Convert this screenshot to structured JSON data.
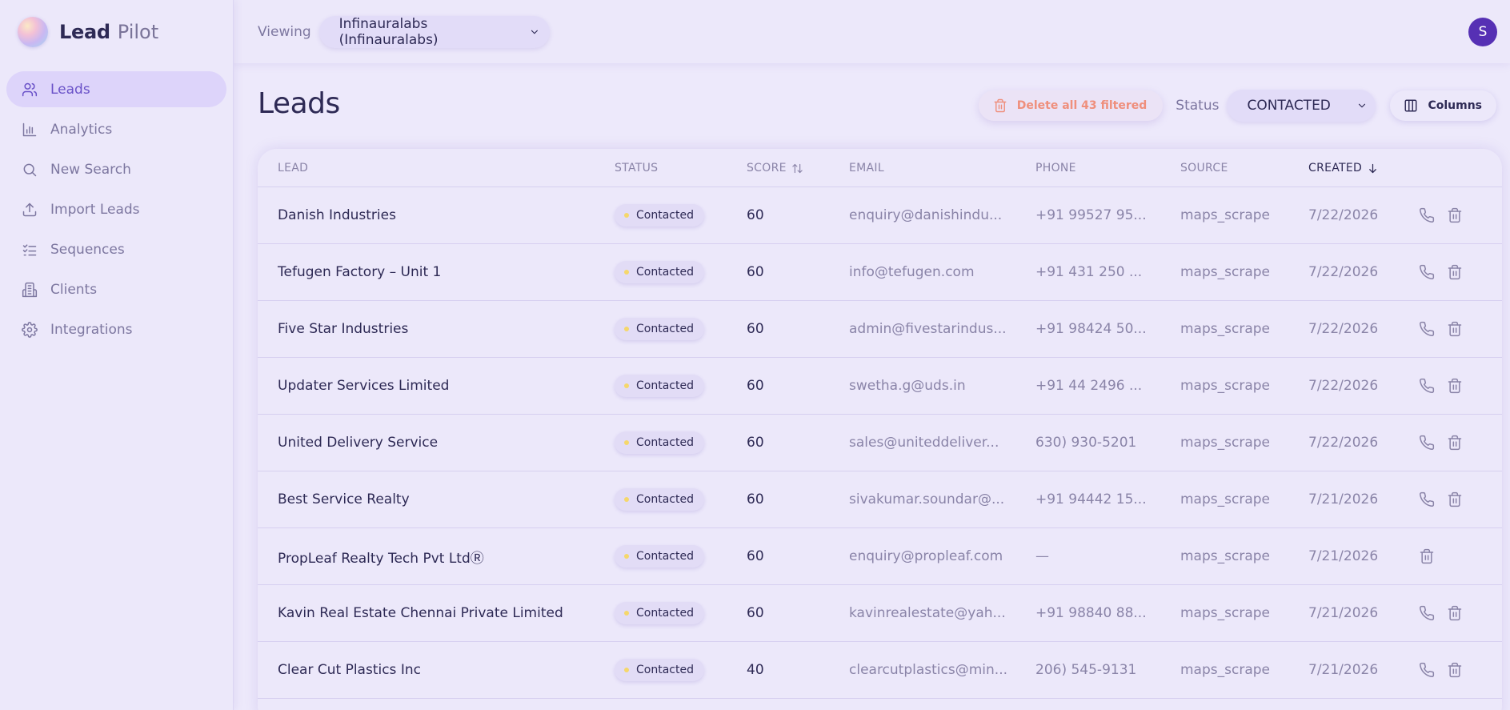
{
  "brand": {
    "name": "Lead",
    "suffix": "Pilot"
  },
  "nav": [
    {
      "label": "Leads",
      "icon": "users-icon",
      "active": true
    },
    {
      "label": "Analytics",
      "icon": "bar-chart-icon",
      "active": false
    },
    {
      "label": "New Search",
      "icon": "search-icon",
      "active": false
    },
    {
      "label": "Import Leads",
      "icon": "upload-icon",
      "active": false
    },
    {
      "label": "Sequences",
      "icon": "list-checks-icon",
      "active": false
    },
    {
      "label": "Clients",
      "icon": "building-icon",
      "active": false
    },
    {
      "label": "Integrations",
      "icon": "gear-icon",
      "active": false
    }
  ],
  "topbar": {
    "viewing_label": "Viewing",
    "org": "Infinauralabs (Infinauralabs)",
    "avatar_initial": "S"
  },
  "page": {
    "title": "Leads",
    "delete_label": "Delete all 43 filtered",
    "status_label": "Status",
    "status_value": "CONTACTED",
    "columns_label": "Columns"
  },
  "table": {
    "headers": {
      "lead": "LEAD",
      "status": "STATUS",
      "score": "SCORE",
      "email": "EMAIL",
      "phone": "PHONE",
      "source": "SOURCE",
      "created": "CREATED"
    },
    "rows": [
      {
        "lead": "Danish Industries",
        "status": "Contacted",
        "score": "60",
        "email": "enquiry@danishindu...",
        "phone": "+91 99527 95...",
        "source": "maps_scrape",
        "created": "7/22/2026",
        "has_phone": true
      },
      {
        "lead": "Tefugen Factory – Unit 1",
        "status": "Contacted",
        "score": "60",
        "email": "info@tefugen.com",
        "phone": "+91 431 250 ...",
        "source": "maps_scrape",
        "created": "7/22/2026",
        "has_phone": true
      },
      {
        "lead": "Five Star Industries",
        "status": "Contacted",
        "score": "60",
        "email": "admin@fivestarindus...",
        "phone": "+91 98424 50...",
        "source": "maps_scrape",
        "created": "7/22/2026",
        "has_phone": true
      },
      {
        "lead": "Updater Services Limited",
        "status": "Contacted",
        "score": "60",
        "email": "swetha.g@uds.in",
        "phone": "+91 44 2496 ...",
        "source": "maps_scrape",
        "created": "7/22/2026",
        "has_phone": true
      },
      {
        "lead": "United Delivery Service",
        "status": "Contacted",
        "score": "60",
        "email": "sales@uniteddeliver...",
        "phone": "630) 930-5201",
        "source": "maps_scrape",
        "created": "7/22/2026",
        "has_phone": true
      },
      {
        "lead": "Best Service Realty",
        "status": "Contacted",
        "score": "60",
        "email": "sivakumar.soundar@...",
        "phone": "+91 94442 15...",
        "source": "maps_scrape",
        "created": "7/21/2026",
        "has_phone": true
      },
      {
        "lead": "PropLeaf Realty Tech Pvt LtdⓇ",
        "status": "Contacted",
        "score": "60",
        "email": "enquiry@propleaf.com",
        "phone": "—",
        "source": "maps_scrape",
        "created": "7/21/2026",
        "has_phone": false
      },
      {
        "lead": "Kavin Real Estate Chennai Private Limited",
        "status": "Contacted",
        "score": "60",
        "email": "kavinrealestate@yah...",
        "phone": "+91 98840 88...",
        "source": "maps_scrape",
        "created": "7/21/2026",
        "has_phone": true
      },
      {
        "lead": "Clear Cut Plastics Inc",
        "status": "Contacted",
        "score": "40",
        "email": "clearcutplastics@min...",
        "phone": "206) 545-9131",
        "source": "maps_scrape",
        "created": "7/21/2026",
        "has_phone": true
      }
    ]
  },
  "colors": {
    "accent": "#6a52c8",
    "danger": "#ef8f7c",
    "status_dot": "#f5d76b",
    "avatar": "#5630b4"
  }
}
